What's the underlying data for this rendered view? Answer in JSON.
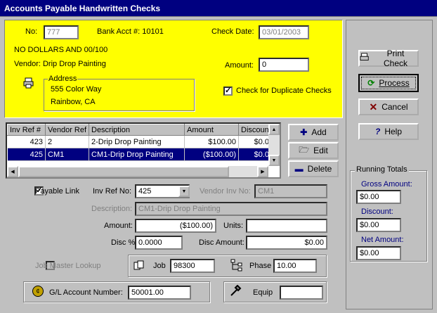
{
  "window": {
    "title": "Accounts Payable Handwritten Checks"
  },
  "check": {
    "no_label": "No:",
    "no_value": "777",
    "bank_label": "Bank Acct #:",
    "bank_value": "10101",
    "date_label": "Check Date:",
    "date_value": "03/01/2003",
    "amount_words": "NO DOLLARS AND 00/100",
    "amount_label": "Amount:",
    "amount_value": "0",
    "vendor_label": "Vendor:",
    "vendor_value": "Drip Drop Painting",
    "address_label": "Address",
    "address_line1": "555 Color Way",
    "address_line2": "Rainbow, CA",
    "dup_label": "Check for Duplicate Checks"
  },
  "grid": {
    "columns": [
      "Inv Ref #",
      "Vendor Ref",
      "Description",
      "Amount",
      "Discount"
    ],
    "rows": [
      {
        "inv": "423",
        "vendor_ref": "2",
        "desc": "2-Drip Drop Painting",
        "amount": "$100.00",
        "discount": "$0.0"
      },
      {
        "inv": "425",
        "vendor_ref": "CM1",
        "desc": "CM1-Drip Drop Painting",
        "amount": "($100.00)",
        "discount": "$0.0"
      }
    ]
  },
  "grid_buttons": {
    "add": "Add",
    "edit": "Edit",
    "delete": "Delete"
  },
  "detail": {
    "payable_link": "Payable Link",
    "inv_ref_label": "Inv Ref No:",
    "inv_ref_value": "425",
    "vendor_inv_label": "Vendor Inv No:",
    "vendor_inv_value": "CM1",
    "desc_label": "Description:",
    "desc_value": "CM1-Drip Drop Painting",
    "amount_label": "Amount:",
    "amount_value": "($100.00)",
    "units_label": "Units:",
    "units_value": "",
    "disc_pct_label": "Disc %",
    "disc_pct_value": "0.0000",
    "disc_amt_label": "Disc Amount:",
    "disc_amt_value": "$0.00",
    "job_master": "Job Master Lookup",
    "job_label": "Job",
    "job_value": "98300",
    "phase_label": "Phase",
    "phase_value": "10.00",
    "gl_label": "G/L Account Number:",
    "gl_value": "50001.00",
    "equip_label": "Equip",
    "equip_value": ""
  },
  "actions": {
    "print": "Print Check",
    "process": "Process",
    "cancel": "Cancel",
    "help": "Help"
  },
  "totals": {
    "title": "Running Totals",
    "gross_label": "Gross Amount:",
    "gross_value": "$0.00",
    "discount_label": "Discount:",
    "discount_value": "$0.00",
    "net_label": "Net Amount:",
    "net_value": "$0.00"
  },
  "colors": {
    "title_bar": "#000080",
    "header_area": "#ffff00",
    "selection": "#000080",
    "totals_label": "#000080"
  }
}
